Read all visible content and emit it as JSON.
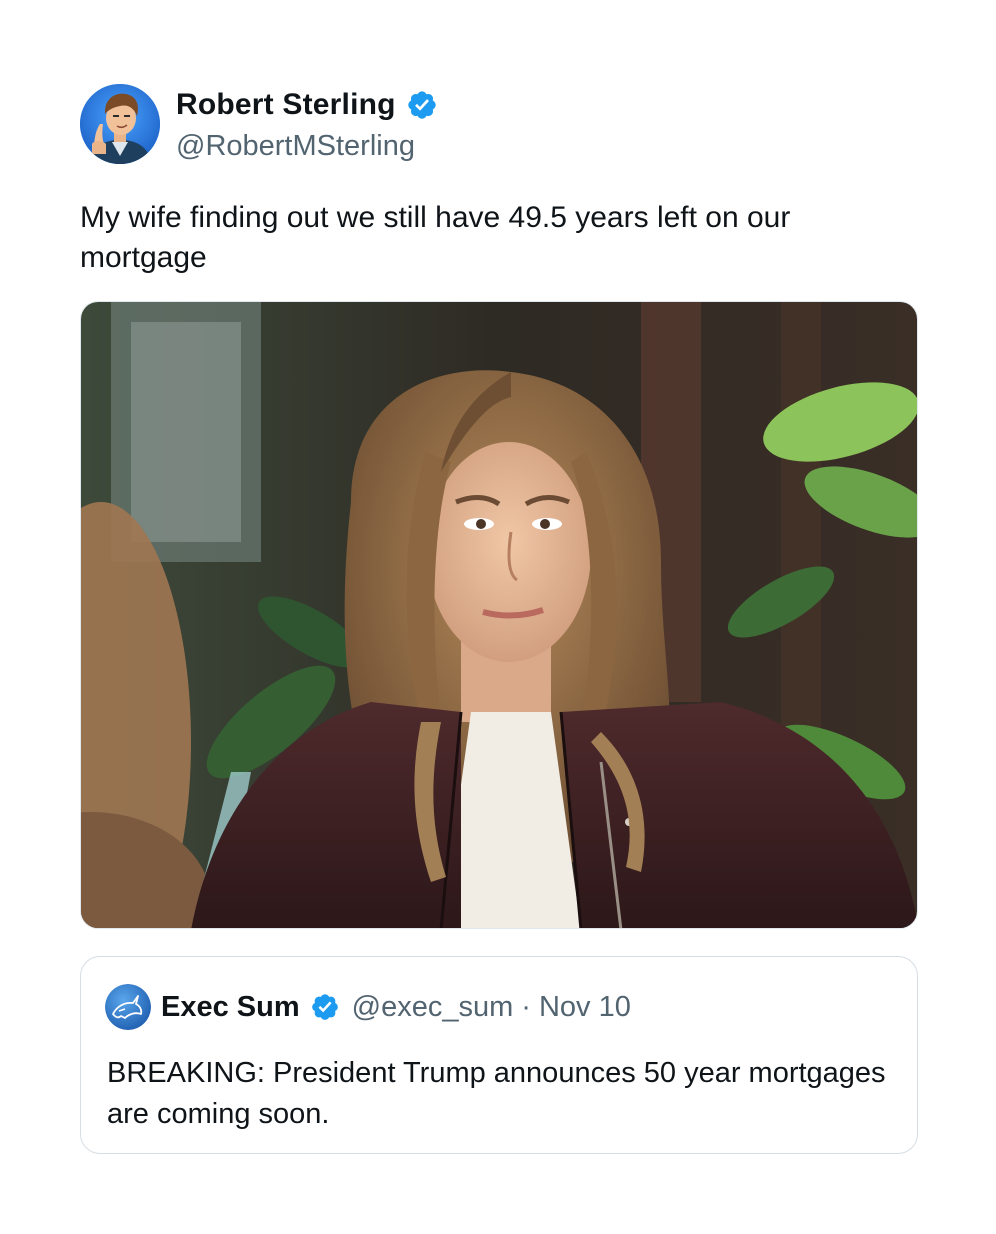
{
  "tweet": {
    "author_name": "Robert Sterling",
    "author_handle": "@RobertMSterling",
    "verified": true,
    "text": "My wife finding out we still have 49.5 years left on our mortgage",
    "media_description_icon": "photo-image"
  },
  "quoted_tweet": {
    "author_name": "Exec Sum",
    "author_handle": "@exec_sum",
    "separator": "·",
    "date": "Nov 10",
    "verified": true,
    "text": "BREAKING: President Trump announces 50 year mortgages are coming soon."
  },
  "colors": {
    "verified_badge": "#1d9bf0",
    "secondary_text": "#536471",
    "primary_text": "#0f1419",
    "border": "#d6dde3"
  },
  "icons": {
    "verified": "verified-badge-icon",
    "author_avatar": "cartoon-man-avatar",
    "quoted_avatar": "unicorn-logo-avatar"
  }
}
